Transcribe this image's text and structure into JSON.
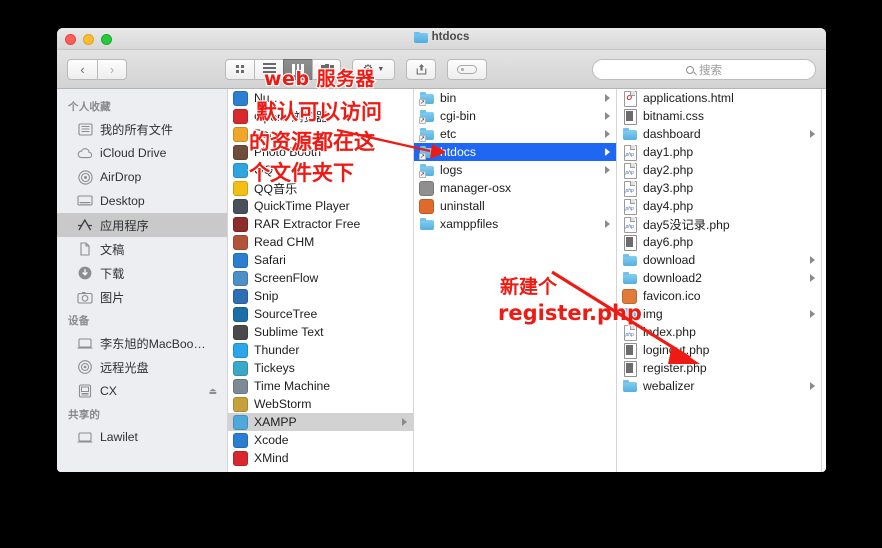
{
  "window": {
    "title": "htdocs",
    "title_icon": "folder-icon",
    "traffic_lights": [
      "close",
      "minimize",
      "maximize"
    ]
  },
  "toolbar": {
    "back_label": "‹",
    "forward_label": "›",
    "view_modes": [
      {
        "name": "icon-view",
        "icon": "grid-icon",
        "active": false
      },
      {
        "name": "list-view",
        "icon": "list-icon",
        "active": false
      },
      {
        "name": "column-view",
        "icon": "columns-icon",
        "active": true
      },
      {
        "name": "coverflow-view",
        "icon": "coverflow-icon",
        "active": false
      }
    ],
    "action_label": "gear-icon",
    "share_label": "share-icon",
    "tag_label": "tag-icon",
    "search": {
      "placeholder": "搜索",
      "value": "",
      "icon": "search-icon"
    }
  },
  "sidebar": {
    "sections": [
      {
        "header": "个人收藏",
        "items": [
          {
            "label": "我的所有文件",
            "icon": "all-my-files-icon",
            "selected": false
          },
          {
            "label": "iCloud Drive",
            "icon": "cloud-icon",
            "selected": false
          },
          {
            "label": "AirDrop",
            "icon": "airdrop-icon",
            "selected": false
          },
          {
            "label": "Desktop",
            "icon": "desktop-icon",
            "selected": false
          },
          {
            "label": "应用程序",
            "icon": "applications-icon",
            "selected": true
          },
          {
            "label": "文稿",
            "icon": "documents-icon",
            "selected": false
          },
          {
            "label": "下载",
            "icon": "downloads-icon",
            "selected": false
          },
          {
            "label": "图片",
            "icon": "pictures-icon",
            "selected": false
          }
        ]
      },
      {
        "header": "设备",
        "items": [
          {
            "label": "李东旭的MacBoo…",
            "icon": "laptop-icon",
            "selected": false
          },
          {
            "label": "远程光盘",
            "icon": "optical-disc-icon",
            "selected": false
          },
          {
            "label": "CX",
            "icon": "external-drive-icon",
            "selected": false,
            "eject": true
          }
        ]
      },
      {
        "header": "共享的",
        "items": [
          {
            "label": "Lawilet",
            "icon": "shared-computer-icon",
            "selected": false
          }
        ]
      }
    ]
  },
  "columns": [
    {
      "name": "applications-column",
      "items": [
        {
          "label": "Nu…",
          "kind": "app",
          "color": "#2d7fd4",
          "selected": false,
          "disclosure": false
        },
        {
          "label": "Opera 浏览器",
          "kind": "app",
          "color": "#d9272e",
          "selected": false,
          "disclosure": false
        },
        {
          "label": "Pag…",
          "kind": "app",
          "color": "#f0a52b",
          "selected": false,
          "disclosure": false
        },
        {
          "label": "Photo Booth",
          "kind": "app",
          "color": "#6f4d3a",
          "selected": false,
          "disclosure": false
        },
        {
          "label": "QQ",
          "kind": "app",
          "color": "#2fa5e0",
          "selected": false,
          "disclosure": false
        },
        {
          "label": "QQ音乐",
          "kind": "app",
          "color": "#f2c014",
          "selected": false,
          "disclosure": false
        },
        {
          "label": "QuickTime Player",
          "kind": "app",
          "color": "#49505a",
          "selected": false,
          "disclosure": false
        },
        {
          "label": "RAR Extractor Free",
          "kind": "app",
          "color": "#8e2b2b",
          "selected": false,
          "disclosure": false
        },
        {
          "label": "Read CHM",
          "kind": "app",
          "color": "#b2543a",
          "selected": false,
          "disclosure": false
        },
        {
          "label": "Safari",
          "kind": "app",
          "color": "#2b7fd0",
          "selected": false,
          "disclosure": false
        },
        {
          "label": "ScreenFlow",
          "kind": "app",
          "color": "#4d8fc7",
          "selected": false,
          "disclosure": false
        },
        {
          "label": "Snip",
          "kind": "app",
          "color": "#2f6fb5",
          "selected": false,
          "disclosure": false
        },
        {
          "label": "SourceTree",
          "kind": "app",
          "color": "#1b6fa8",
          "selected": false,
          "disclosure": false
        },
        {
          "label": "Sublime Text",
          "kind": "app",
          "color": "#4a4a4a",
          "selected": false,
          "disclosure": false
        },
        {
          "label": "Thunder",
          "kind": "app",
          "color": "#2aa7e8",
          "selected": false,
          "disclosure": false
        },
        {
          "label": "Tickeys",
          "kind": "app",
          "color": "#3aa9c9",
          "selected": false,
          "disclosure": false
        },
        {
          "label": "Time Machine",
          "kind": "app",
          "color": "#7b8a94",
          "selected": false,
          "disclosure": false
        },
        {
          "label": "WebStorm",
          "kind": "app",
          "color": "#c8a03a",
          "selected": false,
          "disclosure": false
        },
        {
          "label": "XAMPP",
          "kind": "app",
          "color": "#4fa8dc",
          "selected": true,
          "disclosure": true
        },
        {
          "label": "Xcode",
          "kind": "app",
          "color": "#2b7fd0",
          "selected": false,
          "disclosure": false
        },
        {
          "label": "XMind",
          "kind": "app",
          "color": "#d9272e",
          "selected": false,
          "disclosure": false
        }
      ]
    },
    {
      "name": "xampp-column",
      "items": [
        {
          "label": "bin",
          "kind": "folder-alias",
          "selected": false,
          "disclosure": true
        },
        {
          "label": "cgi-bin",
          "kind": "folder-alias",
          "selected": false,
          "disclosure": true
        },
        {
          "label": "etc",
          "kind": "folder-alias",
          "selected": false,
          "disclosure": true
        },
        {
          "label": "htdocs",
          "kind": "folder-alias",
          "selected": true,
          "disclosure": true
        },
        {
          "label": "logs",
          "kind": "folder-alias",
          "selected": false,
          "disclosure": true
        },
        {
          "label": "manager-osx",
          "kind": "app",
          "color": "#8f8f8f",
          "selected": false,
          "disclosure": false
        },
        {
          "label": "uninstall",
          "kind": "app",
          "color": "#e06a2a",
          "selected": false,
          "disclosure": false
        },
        {
          "label": "xamppfiles",
          "kind": "folder",
          "selected": false,
          "disclosure": true
        }
      ]
    },
    {
      "name": "htdocs-column",
      "items": [
        {
          "label": "applications.html",
          "kind": "file",
          "badge": "O",
          "badge_color": "#d9272e",
          "selected": false,
          "disclosure": false
        },
        {
          "label": "bitnami.css",
          "kind": "doc2",
          "selected": false,
          "disclosure": false
        },
        {
          "label": "dashboard",
          "kind": "folder",
          "selected": false,
          "disclosure": true
        },
        {
          "label": "day1.php",
          "kind": "file",
          "selected": false,
          "disclosure": false
        },
        {
          "label": "day2.php",
          "kind": "file",
          "selected": false,
          "disclosure": false
        },
        {
          "label": "day3.php",
          "kind": "file",
          "selected": false,
          "disclosure": false
        },
        {
          "label": "day4.php",
          "kind": "file",
          "selected": false,
          "disclosure": false
        },
        {
          "label": "day5没记录.php",
          "kind": "file",
          "selected": false,
          "disclosure": false
        },
        {
          "label": "day6.php",
          "kind": "doc2",
          "selected": false,
          "disclosure": false
        },
        {
          "label": "download",
          "kind": "folder",
          "selected": false,
          "disclosure": true
        },
        {
          "label": "download2",
          "kind": "folder",
          "selected": false,
          "disclosure": true
        },
        {
          "label": "favicon.ico",
          "kind": "app",
          "color": "#e07b3a",
          "selected": false,
          "disclosure": false
        },
        {
          "label": "img",
          "kind": "folder",
          "selected": false,
          "disclosure": true
        },
        {
          "label": "index.php",
          "kind": "file",
          "selected": false,
          "disclosure": false
        },
        {
          "label": "loginout.php",
          "kind": "doc2",
          "selected": false,
          "disclosure": false
        },
        {
          "label": "register.php",
          "kind": "doc2",
          "selected": false,
          "disclosure": false
        },
        {
          "label": "webalizer",
          "kind": "folder",
          "selected": false,
          "disclosure": true
        }
      ]
    }
  ],
  "annotations": {
    "color": "#ee1b14",
    "web_label": "web 服务器",
    "line1": "默认可以访问",
    "line2": "的资源都在这",
    "line3": "个文件夹下",
    "new_label": "新建个",
    "register_label": "register.php"
  }
}
